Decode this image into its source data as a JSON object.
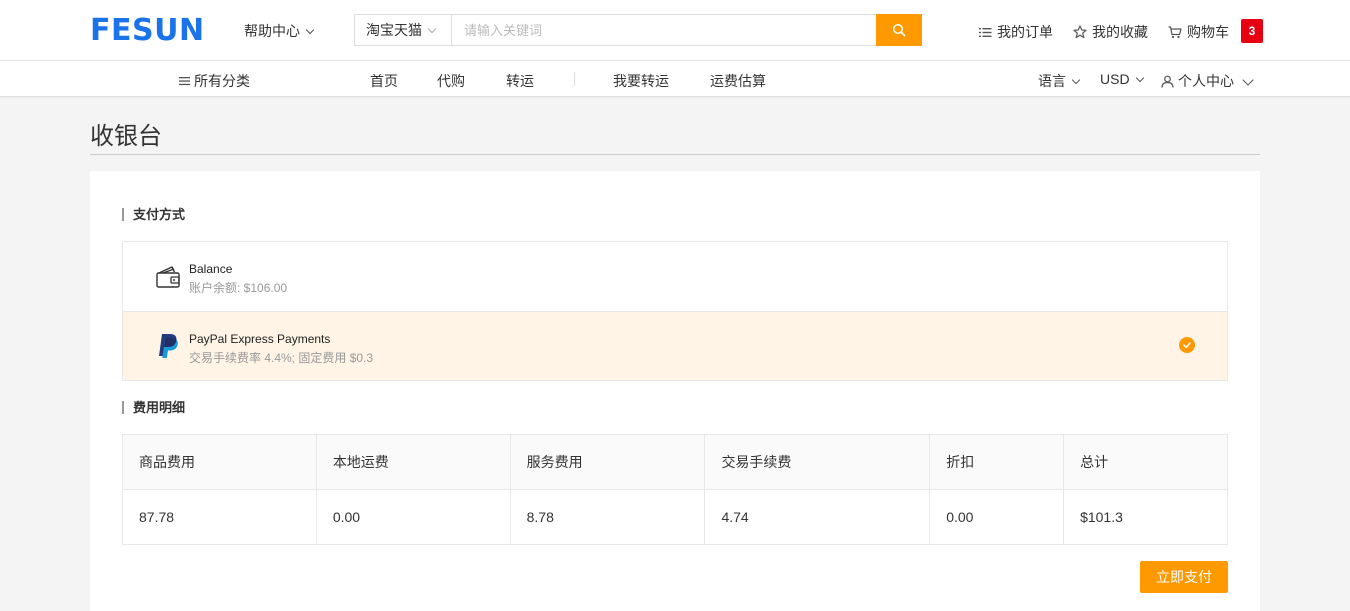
{
  "header": {
    "logo": "FESUN",
    "help_center": "帮助中心",
    "search": {
      "platform": "淘宝天猫",
      "placeholder": "请输入关键词",
      "value": ""
    },
    "links": {
      "orders": "我的订单",
      "favorites": "我的收藏",
      "cart": "购物车",
      "cart_count": "3"
    }
  },
  "nav": {
    "all_categories": "所有分类",
    "items": [
      "首页",
      "代购",
      "转运",
      "我要转运",
      "运费估算"
    ],
    "language": "语言",
    "currency": "USD",
    "account": "个人中心"
  },
  "page": {
    "title": "收银台"
  },
  "payment": {
    "section_label": "支付方式",
    "options": [
      {
        "name": "Balance",
        "desc": "账户余额: $106.00",
        "icon": "wallet-icon",
        "selected": false
      },
      {
        "name": "PayPal Express Payments",
        "desc": "交易手续费率 4.4%; 固定费用 $0.3",
        "icon": "paypal-icon",
        "selected": true
      }
    ]
  },
  "fees": {
    "section_label": "费用明细",
    "headers": [
      "商品费用",
      "本地运费",
      "服务费用",
      "交易手续费",
      "折扣",
      "总计"
    ],
    "values": [
      "87.78",
      "0.00",
      "8.78",
      "4.74",
      "0.00",
      "$101.3"
    ]
  },
  "actions": {
    "pay_now": "立即支付"
  },
  "colors": {
    "brand": "#1a73e8",
    "accent": "#ff9900",
    "badge": "#e60012",
    "selected_bg": "#fff4e6"
  }
}
